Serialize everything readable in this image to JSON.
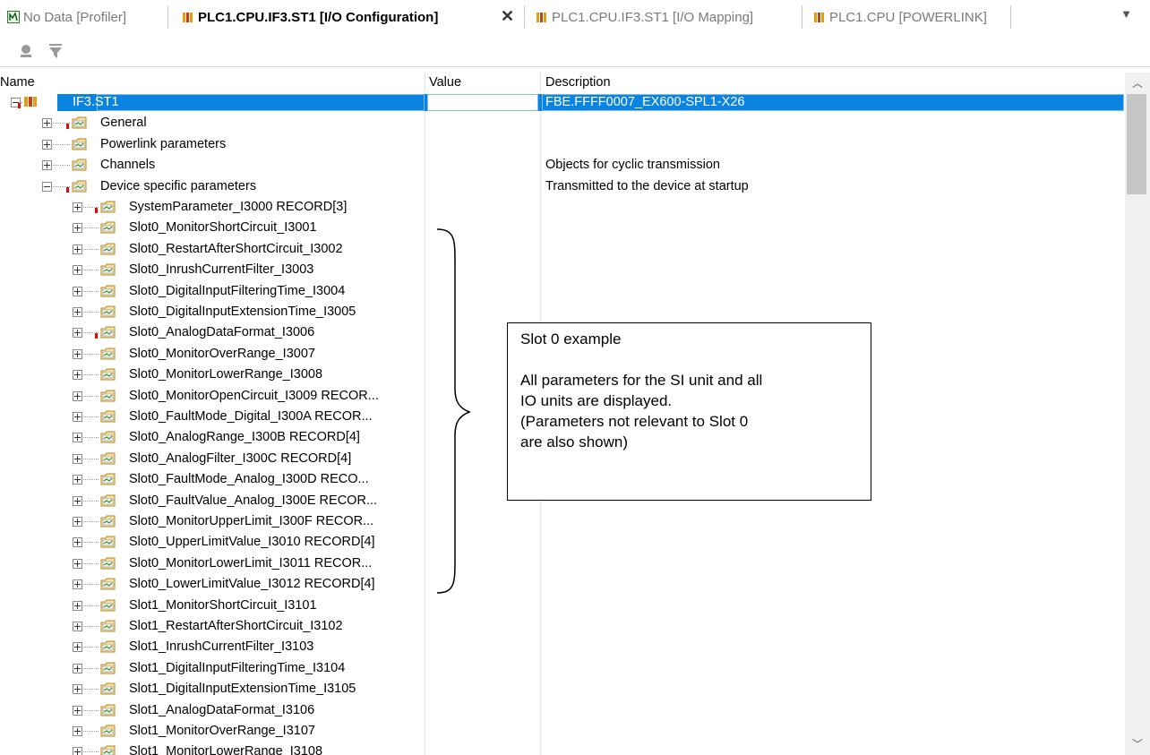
{
  "tabs": [
    {
      "label": "No Data [Profiler]",
      "active": false
    },
    {
      "label": "PLC1.CPU.IF3.ST1 [I/O Configuration]",
      "active": true
    },
    {
      "label": "PLC1.CPU.IF3.ST1 [I/O Mapping]",
      "active": false
    },
    {
      "label": "PLC1.CPU [POWERLINK]",
      "active": false
    }
  ],
  "tab_close": "✕",
  "columns": {
    "name": "Name",
    "value": "Value",
    "description": "Description"
  },
  "rows": [
    {
      "name": "IF3.ST1",
      "desc": "FBE.FFFF0007_EX600-SPL1-X26",
      "level": 0,
      "expanded": true,
      "flag": true,
      "selected": true
    },
    {
      "name": "General",
      "desc": "",
      "level": 1,
      "expanded": false,
      "flag": true
    },
    {
      "name": "Powerlink parameters",
      "desc": "",
      "level": 1,
      "expanded": false,
      "flag": false
    },
    {
      "name": "Channels",
      "desc": "Objects for cyclic transmission",
      "level": 1,
      "expanded": false,
      "flag": false
    },
    {
      "name": "Device specific parameters",
      "desc": "Transmitted to the device at startup",
      "level": 1,
      "expanded": true,
      "flag": true
    },
    {
      "name": "SystemParameter_I3000 RECORD[3]",
      "desc": "",
      "level": 2,
      "expanded": false,
      "flag": true
    },
    {
      "name": "Slot0_MonitorShortCircuit_I3001",
      "desc": "",
      "level": 2,
      "expanded": false,
      "flag": false
    },
    {
      "name": "Slot0_RestartAfterShortCircuit_I3002",
      "desc": "",
      "level": 2,
      "expanded": false,
      "flag": false
    },
    {
      "name": "Slot0_InrushCurrentFilter_I3003",
      "desc": "",
      "level": 2,
      "expanded": false,
      "flag": false
    },
    {
      "name": "Slot0_DigitalInputFilteringTime_I3004",
      "desc": "",
      "level": 2,
      "expanded": false,
      "flag": false
    },
    {
      "name": "Slot0_DigitalInputExtensionTime_I3005",
      "desc": "",
      "level": 2,
      "expanded": false,
      "flag": false
    },
    {
      "name": "Slot0_AnalogDataFormat_I3006",
      "desc": "",
      "level": 2,
      "expanded": false,
      "flag": true
    },
    {
      "name": "Slot0_MonitorOverRange_I3007",
      "desc": "",
      "level": 2,
      "expanded": false,
      "flag": false
    },
    {
      "name": "Slot0_MonitorLowerRange_I3008",
      "desc": "",
      "level": 2,
      "expanded": false,
      "flag": false
    },
    {
      "name": "Slot0_MonitorOpenCircuit_I3009 RECOR...",
      "desc": "",
      "level": 2,
      "expanded": false,
      "flag": false
    },
    {
      "name": "Slot0_FaultMode_Digital_I300A RECOR...",
      "desc": "",
      "level": 2,
      "expanded": false,
      "flag": false
    },
    {
      "name": "Slot0_AnalogRange_I300B RECORD[4]",
      "desc": "",
      "level": 2,
      "expanded": false,
      "flag": false
    },
    {
      "name": "Slot0_AnalogFilter_I300C RECORD[4]",
      "desc": "",
      "level": 2,
      "expanded": false,
      "flag": false
    },
    {
      "name": "Slot0_FaultMode_Analog_I300D RECO...",
      "desc": "",
      "level": 2,
      "expanded": false,
      "flag": false
    },
    {
      "name": "Slot0_FaultValue_Analog_I300E RECOR...",
      "desc": "",
      "level": 2,
      "expanded": false,
      "flag": false
    },
    {
      "name": "Slot0_MonitorUpperLimit_I300F RECOR...",
      "desc": "",
      "level": 2,
      "expanded": false,
      "flag": false
    },
    {
      "name": "Slot0_UpperLimitValue_I3010 RECORD[4]",
      "desc": "",
      "level": 2,
      "expanded": false,
      "flag": false
    },
    {
      "name": "Slot0_MonitorLowerLimit_I3011 RECOR...",
      "desc": "",
      "level": 2,
      "expanded": false,
      "flag": false
    },
    {
      "name": "Slot0_LowerLimitValue_I3012 RECORD[4]",
      "desc": "",
      "level": 2,
      "expanded": false,
      "flag": false
    },
    {
      "name": "Slot1_MonitorShortCircuit_I3101",
      "desc": "",
      "level": 2,
      "expanded": false,
      "flag": false
    },
    {
      "name": "Slot1_RestartAfterShortCircuit_I3102",
      "desc": "",
      "level": 2,
      "expanded": false,
      "flag": false
    },
    {
      "name": "Slot1_InrushCurrentFilter_I3103",
      "desc": "",
      "level": 2,
      "expanded": false,
      "flag": false
    },
    {
      "name": "Slot1_DigitalInputFilteringTime_I3104",
      "desc": "",
      "level": 2,
      "expanded": false,
      "flag": false
    },
    {
      "name": "Slot1_DigitalInputExtensionTime_I3105",
      "desc": "",
      "level": 2,
      "expanded": false,
      "flag": false
    },
    {
      "name": "Slot1_AnalogDataFormat_I3106",
      "desc": "",
      "level": 2,
      "expanded": false,
      "flag": false
    },
    {
      "name": "Slot1_MonitorOverRange_I3107",
      "desc": "",
      "level": 2,
      "expanded": false,
      "flag": false
    },
    {
      "name": "Slot1_MonitorLowerRange_I3108",
      "desc": "",
      "level": 2,
      "expanded": false,
      "flag": false
    }
  ],
  "annotation": {
    "title": "Slot 0 example",
    "line1": "All parameters for the SI unit and all",
    "line2": "IO units are displayed.",
    "line3": "(Parameters not relevant to Slot 0",
    "line4": "are also shown)"
  },
  "colors": {
    "selection": "#0a84e0",
    "flag": "#d21010"
  }
}
